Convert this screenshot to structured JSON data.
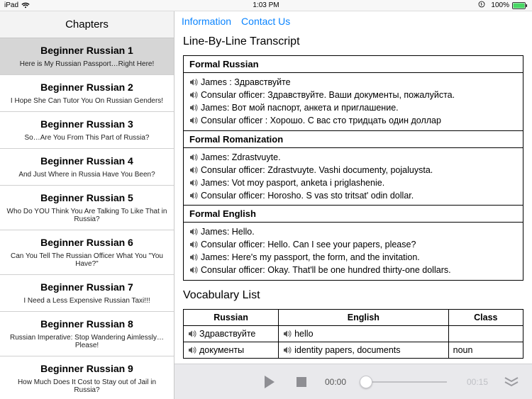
{
  "status": {
    "carrier": "iPad",
    "time": "1:03 PM",
    "battery_pct": "100%"
  },
  "sidebar": {
    "header": "Chapters",
    "items": [
      {
        "title": "Beginner Russian 1",
        "sub": "Here is My Russian Passport…Right Here!",
        "selected": true
      },
      {
        "title": "Beginner Russian 2",
        "sub": "I Hope She Can Tutor You On Russian Genders!"
      },
      {
        "title": "Beginner Russian 3",
        "sub": "So…Are You From This Part of Russia?"
      },
      {
        "title": "Beginner Russian 4",
        "sub": "And Just Where in Russia Have You Been?"
      },
      {
        "title": "Beginner Russian 5",
        "sub": "Who Do YOU Think You Are Talking To Like That in Russia?"
      },
      {
        "title": "Beginner Russian 6",
        "sub": "Can You Tell The Russian Officer What You \"You Have?\""
      },
      {
        "title": "Beginner Russian 7",
        "sub": "I Need a Less Expensive Russian Taxi!!!"
      },
      {
        "title": "Beginner Russian 8",
        "sub": "Russian Imperative: Stop Wandering Aimlessly…Please!"
      },
      {
        "title": "Beginner Russian 9",
        "sub": "How Much Does It Cost to Stay out of Jail in Russia?"
      }
    ]
  },
  "tabs": {
    "information": "Information",
    "contact": "Contact Us"
  },
  "transcript": {
    "heading": "Line-By-Line Transcript",
    "sections": [
      {
        "label": "Formal Russian",
        "lines": [
          "James : Здравствуйте",
          "Consular officer: Здравствуйте. Ваши документы, пожалуйста.",
          "James: Вот мой паспорт, анкета и приглашение.",
          "Consular officer : Хорошо. С вас сто тридцать один доллар"
        ]
      },
      {
        "label": "Formal Romanization",
        "lines": [
          "James: Zdrastvuyte.",
          "Consular officer: Zdrastvuyte. Vashi documenty, pojaluysta.",
          "James: Vot moy pasport, anketa i priglashenie.",
          "Consular officer: Horosho. S vas sto tritsat' odin dollar."
        ]
      },
      {
        "label": "Formal English",
        "lines": [
          "James: Hello.",
          "Consular officer: Hello. Can I see your papers, please?",
          "James: Here's my passport, the form, and the invitation.",
          "Consular officer: Okay. That'll be one hundred thirty-one dollars."
        ]
      }
    ]
  },
  "vocab": {
    "heading": "Vocabulary List",
    "headers": {
      "c0": "Russian",
      "c1": "English",
      "c2": "Class"
    },
    "rows": [
      {
        "c0": "Здравствуйте",
        "c1": "hello",
        "c2": ""
      },
      {
        "c0": "документы",
        "c1": "identity papers, documents",
        "c2": "noun"
      }
    ]
  },
  "player": {
    "current": "00:00",
    "total": "00:15"
  }
}
